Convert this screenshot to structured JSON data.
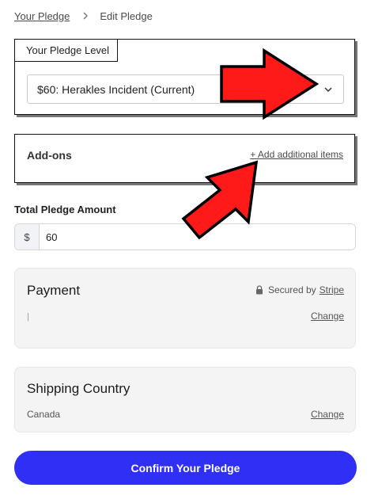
{
  "breadcrumb": {
    "parent": "Your Pledge",
    "current": "Edit Pledge"
  },
  "pledge_level": {
    "label": "Your Pledge Level",
    "selected": "$60: Herakles Incident (Current)"
  },
  "addons": {
    "title": "Add-ons",
    "link": "+ Add additional items"
  },
  "total": {
    "label": "Total Pledge Amount",
    "currency": "$",
    "value": "60"
  },
  "payment": {
    "title": "Payment",
    "secured_prefix": "Secured by",
    "secured_provider": "Stripe",
    "detail": "|",
    "change": "Change"
  },
  "shipping": {
    "title": "Shipping Country",
    "country": "Canada",
    "change": "Change"
  },
  "confirm": {
    "label": "Confirm Your Pledge"
  },
  "colors": {
    "primary_button": "#2f2ff5",
    "annotation_arrow": "#ff0000"
  },
  "icons": {
    "breadcrumb_separator": "chevron-right-icon",
    "select_dropdown": "chevron-down-icon",
    "secured": "lock-icon",
    "annotation": "red-arrow-icon"
  }
}
